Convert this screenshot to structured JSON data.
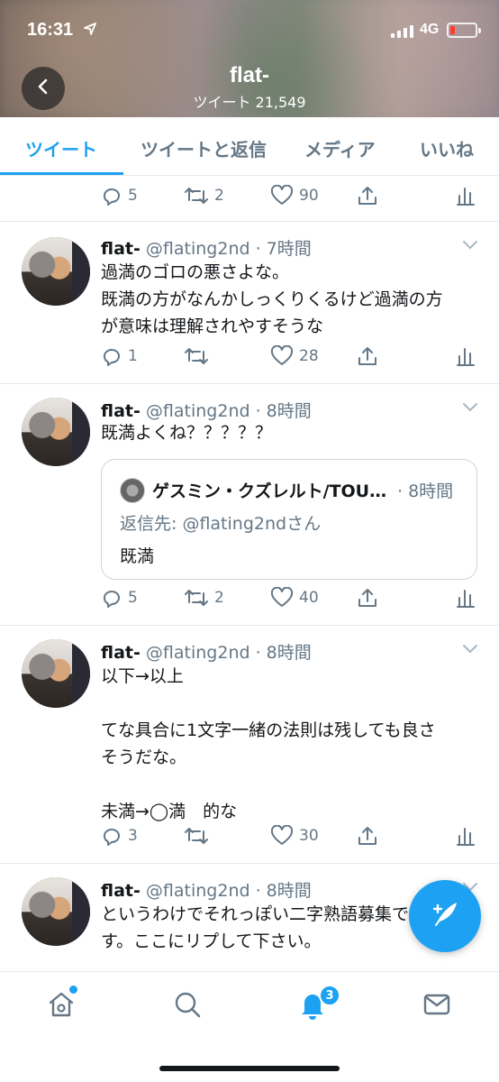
{
  "status_bar": {
    "time": "16:31",
    "network": "4G",
    "battery_level": 0.2,
    "battery_color": "#ff3b30"
  },
  "header": {
    "title": "flat-",
    "subtitle": "ツイート 21,549"
  },
  "tabs": [
    {
      "label": "ツイート",
      "active": true
    },
    {
      "label": "ツイートと返信",
      "active": false
    },
    {
      "label": "メディア",
      "active": false
    },
    {
      "label": "いいね",
      "active": false
    }
  ],
  "accent_color": "#1da1f2",
  "top_actions": {
    "replies": "5",
    "retweets": "2",
    "likes": "90"
  },
  "tweets": [
    {
      "name": "flat-",
      "handle": "@flating2nd · 7時間",
      "text": "過満のゴロの悪さよな。\n既満の方がなんかしっくりくるけど過満の方\nが意味は理解されやすそうな",
      "replies": "1",
      "retweets": "",
      "likes": "28"
    },
    {
      "name": "flat-",
      "handle": "@flating2nd · 8時間",
      "text": "既満よくね？？？？？",
      "quote": {
        "name": "ゲスミン・クズレルト/TOUGOU",
        "time": "· 8時間",
        "reply_to": "返信先: @flating2ndさん",
        "body": "既満"
      },
      "replies": "5",
      "retweets": "2",
      "likes": "40"
    },
    {
      "name": "flat-",
      "handle": "@flating2nd · 8時間",
      "text": "以下→以上\n\nてな具合に1文字一緒の法則は残しても良さ\nそうだな。\n\n未満→◯満　的な",
      "replies": "3",
      "retweets": "",
      "likes": "30"
    },
    {
      "name": "flat-",
      "handle": "@flating2nd · 8時間",
      "text": "というわけでそれっぽい二字熟語募集で\nす。ここにリプして下さい。"
    }
  ],
  "bottom_nav": {
    "notification_count": "3"
  },
  "icons": [
    "back-icon",
    "location-icon",
    "reply-icon",
    "retweet-icon",
    "like-icon",
    "share-icon",
    "analytics-icon",
    "chevron-down-icon",
    "compose-icon",
    "home-icon",
    "search-icon",
    "notifications-icon",
    "messages-icon"
  ]
}
